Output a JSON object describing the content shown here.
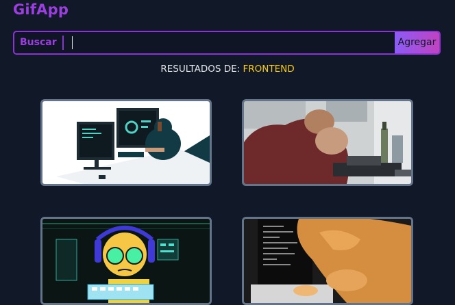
{
  "app": {
    "title": "GifApp"
  },
  "search": {
    "label": "Buscar",
    "value": "",
    "button_label": "Agregar"
  },
  "results": {
    "prefix": "RESULTADOS DE: ",
    "term": "FRONTEND"
  },
  "gifs": [
    {
      "alt": "developer-at-desk-illustration"
    },
    {
      "alt": "frustrated-man-at-computer"
    },
    {
      "alt": "cartoon-hacker-with-headphones"
    },
    {
      "alt": "cat-typing-on-laptop"
    }
  ],
  "colors": {
    "background": "#111827",
    "accent": "#9b3fe0",
    "term_highlight": "#facc15",
    "card_border": "#64748b"
  }
}
